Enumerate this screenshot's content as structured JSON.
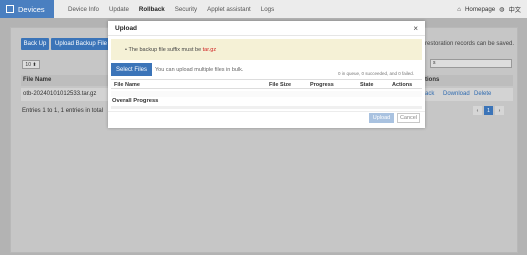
{
  "app": {
    "brand": "Devices"
  },
  "nav": {
    "items": [
      "Device Info",
      "Update",
      "Rollback",
      "Security",
      "Applet assistant",
      "Logs"
    ],
    "active": "Rollback"
  },
  "top_right": {
    "homepage": "Homepage",
    "language": "中文"
  },
  "toolbar": {
    "backup_label": "Back Up",
    "upload_backup_label": "Upload Backup File"
  },
  "info": {
    "restoration_note": "restoration records can be saved."
  },
  "list": {
    "page_size": "10",
    "search_placeholder": "s",
    "column_file_name": "File Name",
    "column_actions": "tions",
    "rows": [
      {
        "file_name": "otb-20240101012533.tar.gz",
        "rollback": "ack",
        "download": "Download",
        "delete": "Delete"
      }
    ],
    "summary": "Entries 1 to 1, 1 entries in total",
    "pager": {
      "prev": "‹",
      "current": "1",
      "next": "›"
    }
  },
  "modal": {
    "title": "Upload",
    "close": "×",
    "notice_prefix": "The backup file suffix must be ",
    "notice_suffix_value": "tar.gz",
    "select_files_label": "Select Files",
    "multi_hint": "You can upload multiple files in bulk.",
    "queue_status": "0 in queue, 0 succeeded, and 0 failed.",
    "columns": {
      "file_name": "File Name",
      "file_size": "File Size",
      "progress": "Progress",
      "state": "State",
      "actions": "Actions"
    },
    "overall_progress_label": "Overall Progress",
    "overall_progress": 0,
    "upload_label": "Upload",
    "cancel_label": "Cancel"
  }
}
